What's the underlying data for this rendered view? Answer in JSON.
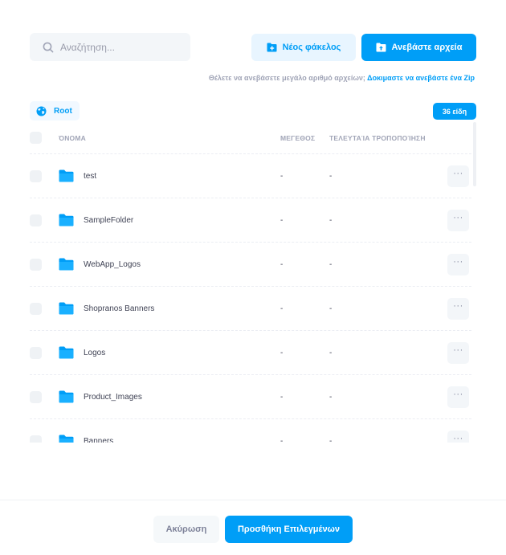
{
  "search": {
    "placeholder": "Αναζήτηση..."
  },
  "toolbar": {
    "new_folder_label": "Νέος φάκελος",
    "upload_label": "Ανεβάστε αρχεία"
  },
  "hint": {
    "text": "Θέλετε να ανεβάσετε μεγάλο αριθμό αρχείων;",
    "link": "Δοκιμαστε να ανεβάστε ένα Zip"
  },
  "breadcrumb": {
    "root_label": "Root"
  },
  "badge": {
    "count_label": "36 είδη"
  },
  "table": {
    "headers": {
      "name": "ΌΝΟΜΑ",
      "size": "ΜΕΓΕΘΟΣ",
      "modified": "ΤΕΛΕΥΤΑΊΑ ΤΡΟΠΟΠΟΊΗΣΗ"
    },
    "rows": [
      {
        "name": "test",
        "size": "-",
        "modified": "-"
      },
      {
        "name": "SampleFolder",
        "size": "-",
        "modified": "-"
      },
      {
        "name": "WebApp_Logos",
        "size": "-",
        "modified": "-"
      },
      {
        "name": "Shopranos Banners",
        "size": "-",
        "modified": "-"
      },
      {
        "name": "Logos",
        "size": "-",
        "modified": "-"
      },
      {
        "name": "Product_Images",
        "size": "-",
        "modified": "-"
      },
      {
        "name": "Banners",
        "size": "-",
        "modified": "-"
      }
    ],
    "more_label": "···"
  },
  "footer": {
    "cancel_label": "Ακύρωση",
    "add_label": "Προσθήκη Επιλεγμένων"
  },
  "icons": {
    "search": "search-icon",
    "new_folder": "folder-plus-icon",
    "upload": "upload-icon",
    "root": "globe-icon",
    "folder": "folder-icon",
    "more": "more-dots-icon"
  },
  "colors": {
    "primary": "#009ef7",
    "primary_light": "#e8f5ff",
    "muted": "#a1a5b7",
    "text": "#3f4254"
  }
}
